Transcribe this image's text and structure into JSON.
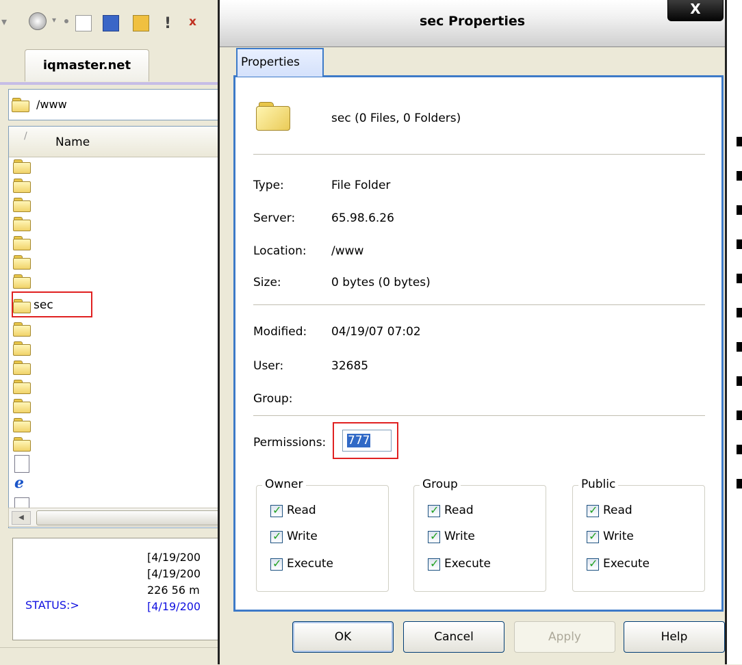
{
  "background_app": {
    "site_tab": "iqmaster.net",
    "path": "/www",
    "list_header": {
      "sort_marker": "/",
      "name": "Name"
    },
    "selected_file": "sec",
    "status_log": [
      "[4/19/200",
      "[4/19/200",
      "226 56 m",
      "[4/19/200"
    ],
    "status_label": "STATUS:>"
  },
  "dialog": {
    "title": "sec Properties",
    "close_label": "X",
    "tab_label": "Properties",
    "summary": "sec (0 Files, 0 Folders)",
    "fields": {
      "type_label": "Type:",
      "type_value": "File Folder",
      "server_label": "Server:",
      "server_value": "65.98.6.26",
      "location_label": "Location:",
      "location_value": "/www",
      "size_label": "Size:",
      "size_value": "0 bytes (0 bytes)",
      "modified_label": "Modified:",
      "modified_value": "04/19/07 07:02",
      "user_label": "User:",
      "user_value": "32685",
      "group_label": "Group:",
      "group_value": ""
    },
    "permissions": {
      "label": "Permissions:",
      "value": "777"
    },
    "groups": {
      "owner": {
        "title": "Owner",
        "read": "Read",
        "write": "Write",
        "execute": "Execute"
      },
      "group": {
        "title": "Group",
        "read": "Read",
        "write": "Write",
        "execute": "Execute"
      },
      "public": {
        "title": "Public",
        "read": "Read",
        "write": "Write",
        "execute": "Execute"
      }
    },
    "buttons": {
      "ok": "OK",
      "cancel": "Cancel",
      "apply": "Apply",
      "help": "Help"
    }
  },
  "colors": {
    "accent": "#3d7ac8",
    "highlight": "#e02020",
    "selection": "#3169c6",
    "status_text": "#1010e0"
  }
}
